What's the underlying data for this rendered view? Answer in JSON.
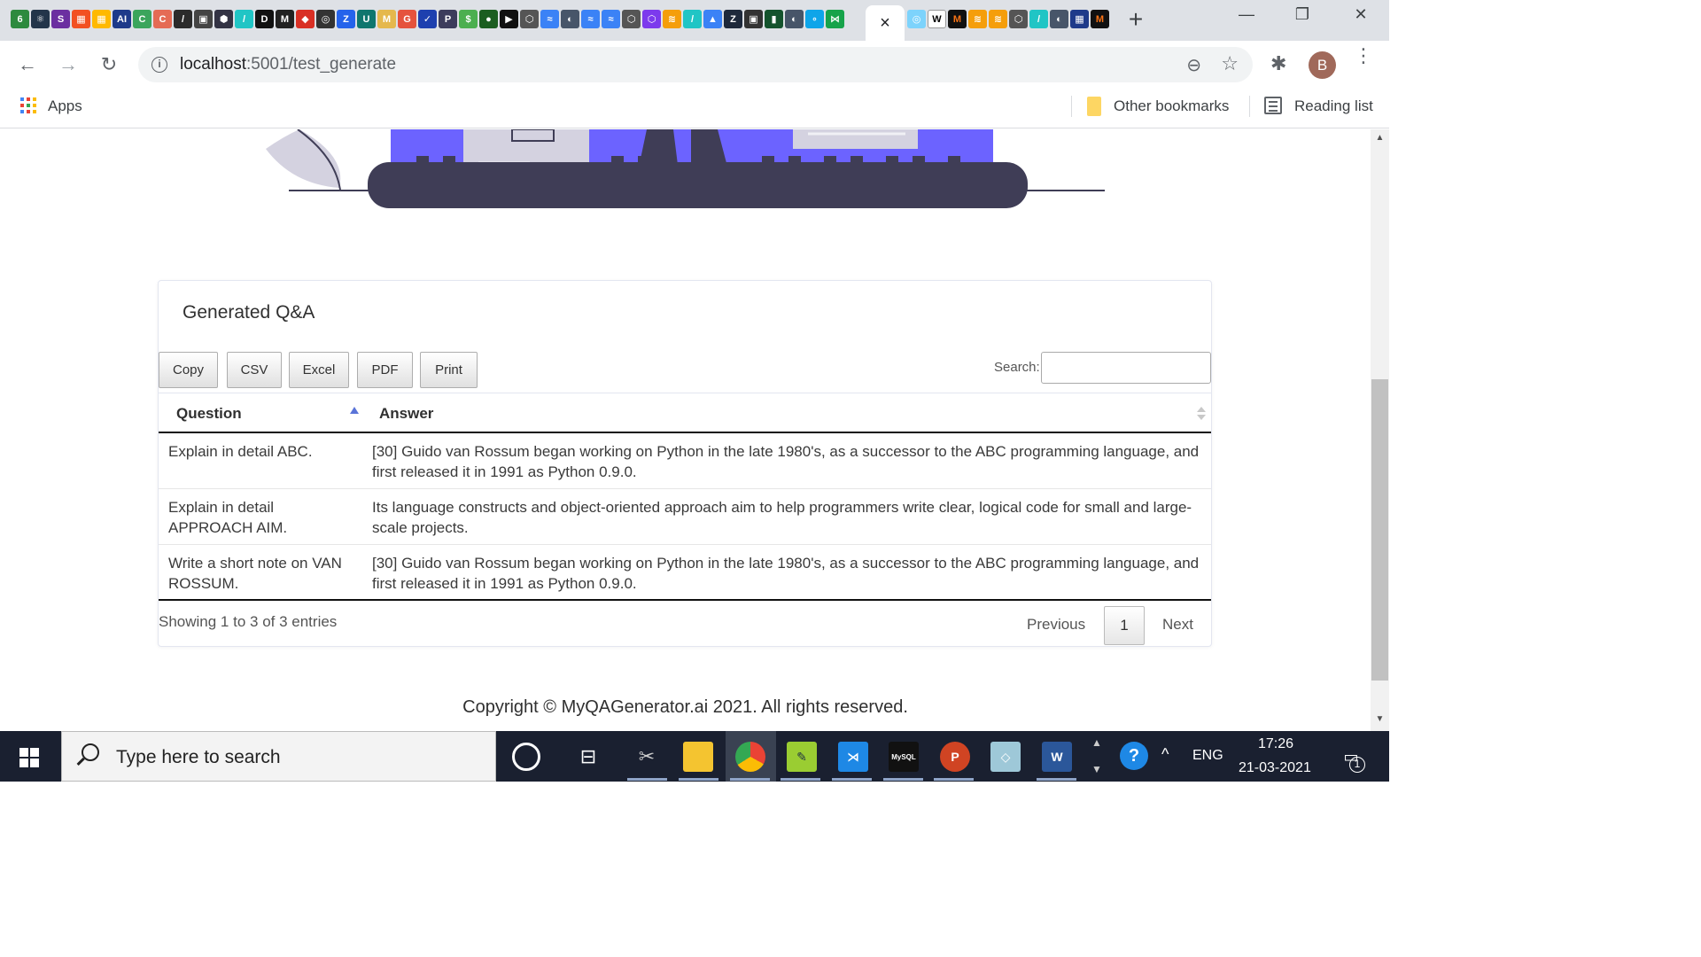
{
  "browser": {
    "active_tab_close": "×",
    "new_tab": "+",
    "window_controls": {
      "minimize": "—",
      "restore": "❐",
      "close": "✕"
    },
    "nav": {
      "back": "←",
      "forward": "→",
      "reload": "↻"
    },
    "url_host": "localhost",
    "url_path": ":5001/test_generate",
    "zoom_icon": "⊖",
    "bookmark_star": "☆",
    "extensions_icon": "✱",
    "profile_initial": "B",
    "menu": "⋮"
  },
  "bookmarks": {
    "apps_label": "Apps",
    "other_label": "Other bookmarks",
    "reading_list_label": "Reading list"
  },
  "card": {
    "title": "Generated Q&A",
    "buttons": {
      "copy": "Copy",
      "csv": "CSV",
      "excel": "Excel",
      "pdf": "PDF",
      "print": "Print"
    },
    "search_label": "Search:",
    "search_value": ""
  },
  "table": {
    "columns": [
      "Question",
      "Answer"
    ],
    "rows": [
      {
        "question": "Explain in detail ABC.",
        "answer": "[30] Guido van Rossum began working on Python in the late 1980's, as a successor to the ABC programming language, and first released it in 1991 as Python 0.9.0."
      },
      {
        "question": "Explain in detail APPROACH AIM.",
        "answer": "Its language constructs and object-oriented approach aim to help programmers write clear, logical code for small and large-scale projects."
      },
      {
        "question": "Write a short note on VAN ROSSUM.",
        "answer": "[30] Guido van Rossum began working on Python in the late 1980's, as a successor to the ABC programming language, and first released it in 1991 as Python 0.9.0."
      }
    ]
  },
  "pagination": {
    "info": "Showing 1 to 3 of 3 entries",
    "previous": "Previous",
    "current": "1",
    "next": "Next"
  },
  "footer": {
    "copyright": "Copyright © MyQAGenerator.ai 2021. All rights reserved."
  },
  "taskbar": {
    "search_placeholder": "Type here to search",
    "lang": "ENG",
    "time": "17:26",
    "date": "21-03-2021",
    "notification_count": "1"
  },
  "colors": {
    "illustration_accent": "#6c63ff",
    "illustration_dark": "#3f3d56",
    "tabstrip_bg": "#dee1e6",
    "taskbar_bg": "#1a2030"
  }
}
